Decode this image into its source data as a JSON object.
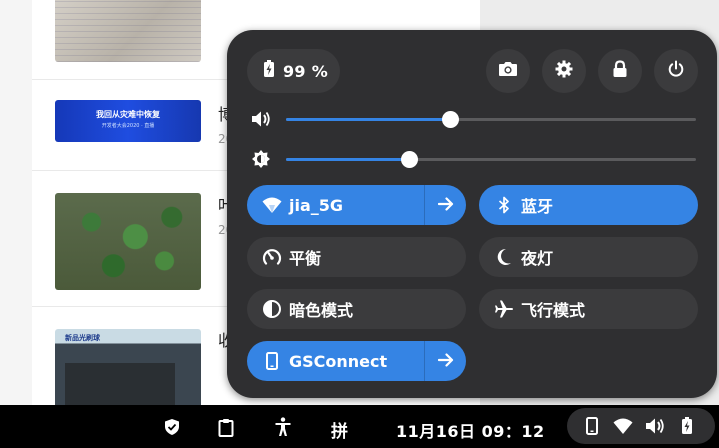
{
  "background_app": {
    "items": [
      {
        "title": "",
        "date": ""
      },
      {
        "title": "博",
        "date": "20",
        "banner_text": "我回从灾难中恢复",
        "banner_sub": "开发者大会2020 · 直播"
      },
      {
        "title": "叶",
        "date": "20"
      },
      {
        "title": "收",
        "date": "",
        "photo_label": "新品光刷球"
      }
    ]
  },
  "quick_settings": {
    "battery": {
      "label": "99 %",
      "icon": "battery-charging-icon"
    },
    "buttons": [
      {
        "name": "screenshot-button",
        "icon": "camera-icon"
      },
      {
        "name": "settings-button",
        "icon": "gear-icon"
      },
      {
        "name": "lock-button",
        "icon": "lock-icon"
      },
      {
        "name": "power-button",
        "icon": "power-icon"
      }
    ],
    "volume": {
      "icon": "speaker-icon",
      "level": 0.4
    },
    "brightness": {
      "icon": "brightness-icon",
      "level": 0.3
    },
    "toggles": {
      "wifi": {
        "label": "jia_5G",
        "icon": "wifi-icon",
        "active": true
      },
      "bluetooth": {
        "label": "蓝牙",
        "icon": "bluetooth-icon",
        "active": true
      },
      "power_mode": {
        "label": "平衡",
        "icon": "speedometer-icon",
        "active": false
      },
      "night_light": {
        "label": "夜灯",
        "icon": "moon-icon",
        "active": false
      },
      "dark_mode": {
        "label": "暗色模式",
        "icon": "contrast-icon",
        "active": false
      },
      "airplane": {
        "label": "飞行模式",
        "icon": "airplane-icon",
        "active": false
      },
      "gsconnect": {
        "label": "GSConnect",
        "icon": "phone-icon",
        "active": true
      }
    },
    "colors": {
      "panel": "#2f2f31",
      "button": "#3b3b3d",
      "accent": "#3584e4"
    }
  },
  "taskbar": {
    "ime": "拼",
    "clock": "11月16日  09：12",
    "icons": [
      "shield-check-icon",
      "clipboard-icon",
      "accessibility-icon",
      "phone-icon",
      "wifi-icon",
      "speaker-icon",
      "battery-charging-icon"
    ]
  }
}
